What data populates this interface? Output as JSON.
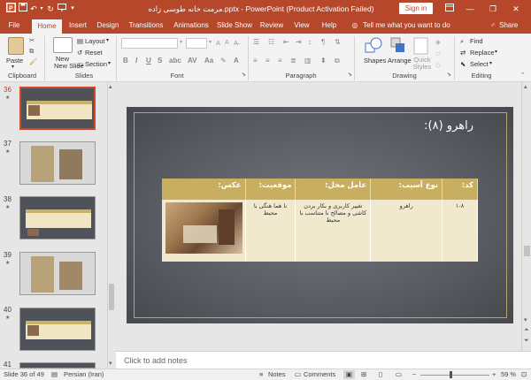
{
  "titlebar": {
    "title": "مرمت خانه طوسی زاده.pptx  -  PowerPoint (Product Activation Failed)",
    "signin": "Sign in"
  },
  "tabs": [
    "File",
    "Home",
    "Insert",
    "Design",
    "Transitions",
    "Animations",
    "Slide Show",
    "Review",
    "View",
    "Help"
  ],
  "tell_me": "Tell me what you want to do",
  "share": "Share",
  "ribbon": {
    "paste": "Paste",
    "new_slide": "New Slide",
    "layout": "Layout",
    "reset": "Reset",
    "section": "Section",
    "shapes": "Shapes",
    "arrange": "Arrange",
    "quick_styles": "Quick Styles",
    "find": "Find",
    "replace": "Replace",
    "select": "Select",
    "groups": {
      "clipboard": "Clipboard",
      "slides": "Slides",
      "font": "Font",
      "paragraph": "Paragraph",
      "drawing": "Drawing",
      "editing": "Editing"
    }
  },
  "thumbnails": [
    {
      "num": "36",
      "selected": true
    },
    {
      "num": "37",
      "selected": false
    },
    {
      "num": "38",
      "selected": false
    },
    {
      "num": "39",
      "selected": false
    },
    {
      "num": "40",
      "selected": false
    },
    {
      "num": "41",
      "selected": false
    }
  ],
  "slide": {
    "title": "راهرو (۸):",
    "table": {
      "headers": [
        "کد:",
        "نوع آسیب:",
        "عامل مخل:",
        "موقعیت:",
        "عکس:"
      ],
      "row": {
        "code": "۱-۸",
        "damage_type": "راهرو",
        "factor": "تغییر کاربری و بکار بردن کاشی و مصالح نا متناسب با محیط",
        "position": "نا هما هنگی با محیط"
      }
    }
  },
  "notes_placeholder": "Click to add notes",
  "status": {
    "slide_info": "Slide 36 of 49",
    "language": "Persian (Iran)",
    "notes": "Notes",
    "comments": "Comments",
    "zoom": "59 %"
  }
}
